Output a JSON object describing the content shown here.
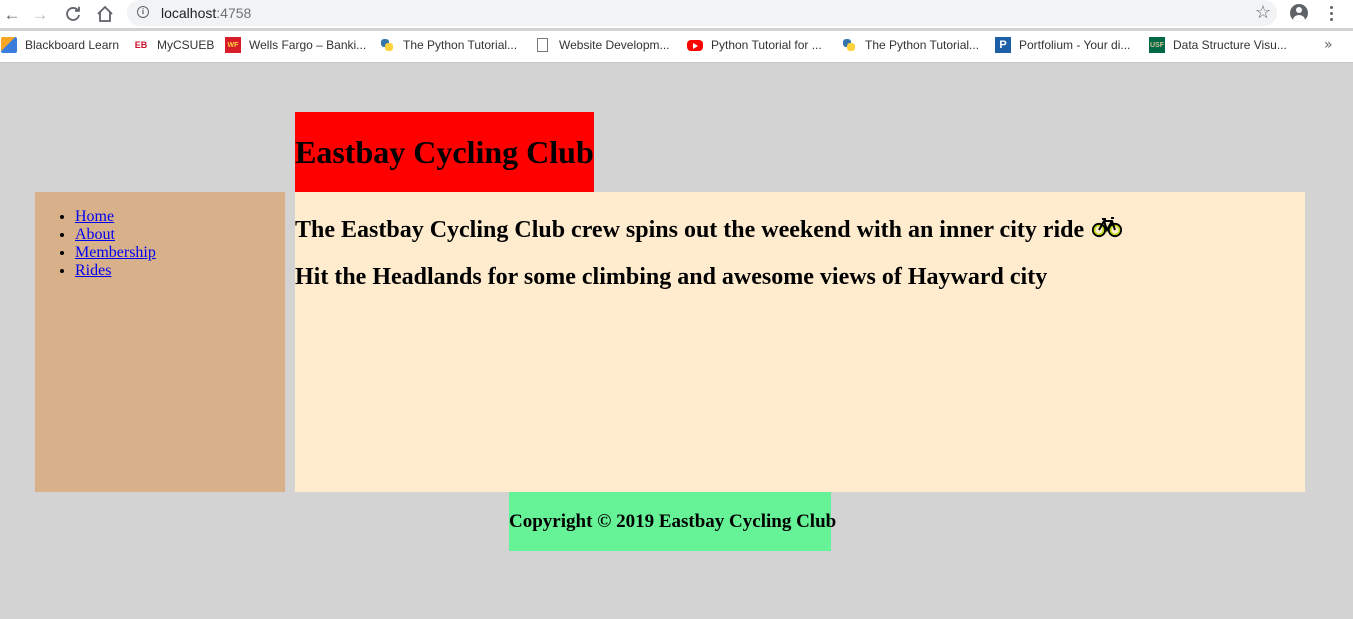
{
  "browser": {
    "url_host": "localhost",
    "url_port": ":4758",
    "bookmarks": [
      {
        "label": "Blackboard Learn",
        "icon": "blackboard-icon"
      },
      {
        "label": "MyCSUEB",
        "icon": "eb-icon"
      },
      {
        "label": "Wells Fargo – Banki...",
        "icon": "wells-fargo-icon"
      },
      {
        "label": "The Python Tutorial...",
        "icon": "python-icon"
      },
      {
        "label": "Website Developm...",
        "icon": "document-icon"
      },
      {
        "label": "Python Tutorial for ...",
        "icon": "youtube-icon"
      },
      {
        "label": "The Python Tutorial...",
        "icon": "python-icon"
      },
      {
        "label": "Portfolium - Your di...",
        "icon": "portfolium-icon"
      },
      {
        "label": "Data Structure Visu...",
        "icon": "usf-icon"
      }
    ],
    "favicon_text": {
      "eb": "EB",
      "wf": "WF",
      "p": "P",
      "usf": "USF"
    }
  },
  "site": {
    "title": "Eastbay Cycling Club",
    "nav": [
      "Home",
      "About",
      "Membership",
      "Rides"
    ],
    "headlines": [
      "The Eastbay Cycling Club crew spins out the weekend with an inner city ride",
      "Hit the Headlands for some climbing and awesome views of Hayward city"
    ],
    "footer": "Copyright © 2019 Eastbay Cycling Club"
  },
  "colors": {
    "page_bg": "#d3d3d3",
    "header_bg": "#ff0000",
    "sidebar_bg": "#d8b18b",
    "main_bg": "#ffebcd",
    "footer_bg": "#66f296",
    "link": "#0000ee"
  }
}
